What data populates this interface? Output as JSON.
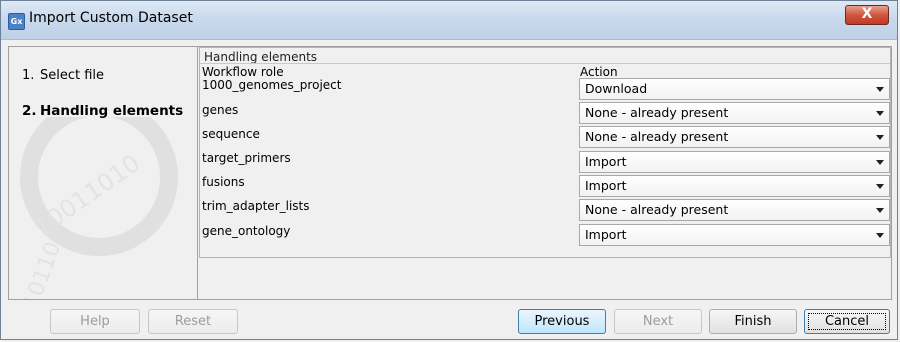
{
  "window": {
    "title": "Import Custom Dataset",
    "app_icon_text": "Gx",
    "close_glyph": "X"
  },
  "steps": [
    {
      "num": "1.",
      "label": "Select file",
      "active": false
    },
    {
      "num": "2.",
      "label": "Handling elements",
      "active": true
    }
  ],
  "handling": {
    "group_title": "Handling elements",
    "col_role": "Workflow role",
    "col_action": "Action",
    "rows": [
      {
        "role": "1000_genomes_project",
        "action": "Download"
      },
      {
        "role": "genes",
        "action": "None - already present"
      },
      {
        "role": "sequence",
        "action": "None - already present"
      },
      {
        "role": "target_primers",
        "action": "Import"
      },
      {
        "role": "fusions",
        "action": "Import"
      },
      {
        "role": "trim_adapter_lists",
        "action": "None - already present"
      },
      {
        "role": "gene_ontology",
        "action": "Import"
      }
    ]
  },
  "buttons": {
    "help": "Help",
    "reset": "Reset",
    "previous": "Previous",
    "next": "Next",
    "finish": "Finish",
    "cancel": "Cancel"
  },
  "colors": {
    "titlebar": "#c9d9ec",
    "close": "#c23a24",
    "primary_button": "#bee6fd"
  }
}
